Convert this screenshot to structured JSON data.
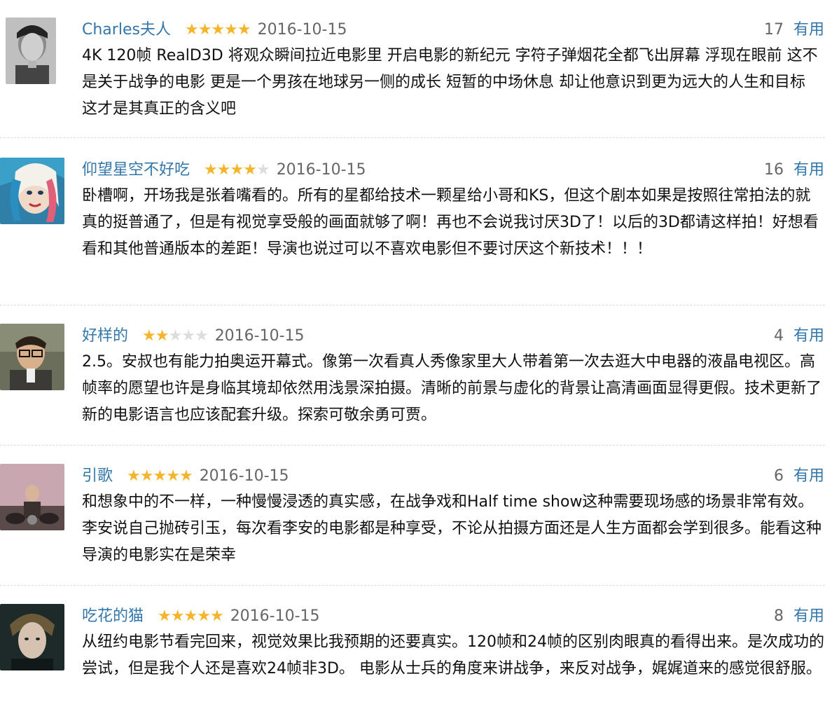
{
  "comments": [
    {
      "author": "Charles夫人",
      "rating": 5,
      "date": "2016-10-15",
      "votes": "17",
      "useful_label": "有用",
      "text": "4K 120帧 RealD3D 将观众瞬间拉近电影里 开启电影的新纪元 字符子弹烟花全都飞出屏幕 浮现在眼前 这不是关于战争的电影 更是一个男孩在地球另一侧的成长 短暂的中场休息 却让他意识到更为远大的人生和目标 这才是其真正的含义吧"
    },
    {
      "author": "仰望星空不好吃",
      "rating": 4,
      "date": "2016-10-15",
      "votes": "16",
      "useful_label": "有用",
      "text": "卧槽啊，开场我是张着嘴看的。所有的星都给技术一颗星给小哥和KS，但这个剧本如果是按照往常拍法的就真的挺普通了，但是有视觉享受般的画面就够了啊！再也不会说我讨厌3D了！以后的3D都请这样拍！好想看看和其他普通版本的差距！导演也说过可以不喜欢电影但不要讨厌这个新技术！！！"
    },
    {
      "author": "好样的",
      "rating": 2,
      "date": "2016-10-15",
      "votes": "4",
      "useful_label": "有用",
      "text": "2.5。安叔也有能力拍奥运开幕式。像第一次看真人秀像家里大人带着第一次去逛大中电器的液晶电视区。高帧率的愿望也许是身临其境却依然用浅景深拍摄。清晰的前景与虚化的背景让高清画面显得更假。技术更新了新的电影语言也应该配套升级。探索可敬余勇可贾。"
    },
    {
      "author": "引歌",
      "rating": 5,
      "date": "2016-10-15",
      "votes": "6",
      "useful_label": "有用",
      "text": "和想象中的不一样，一种慢慢浸透的真实感，在战争戏和Half time show这种需要现场感的场景非常有效。李安说自己抛砖引玉，每次看李安的电影都是种享受，不论从拍摄方面还是人生方面都会学到很多。能看这种导演的电影实在是荣幸"
    },
    {
      "author": "吃花的猫",
      "rating": 5,
      "date": "2016-10-15",
      "votes": "8",
      "useful_label": "有用",
      "text": "从纽约电影节看完回来，视觉效果比我预期的还要真实。120帧和24帧的区别肉眼真的看得出来。是次成功的尝试，但是我个人还是喜欢24帧非3D。 电影从士兵的角度来讲战争，来反对战争，娓娓道来的感觉很舒服。"
    }
  ],
  "colors": {
    "link": "#3377aa",
    "star_on": "#f5b42a",
    "star_off": "#dddddd",
    "meta": "#666666"
  },
  "star_glyph": "★"
}
